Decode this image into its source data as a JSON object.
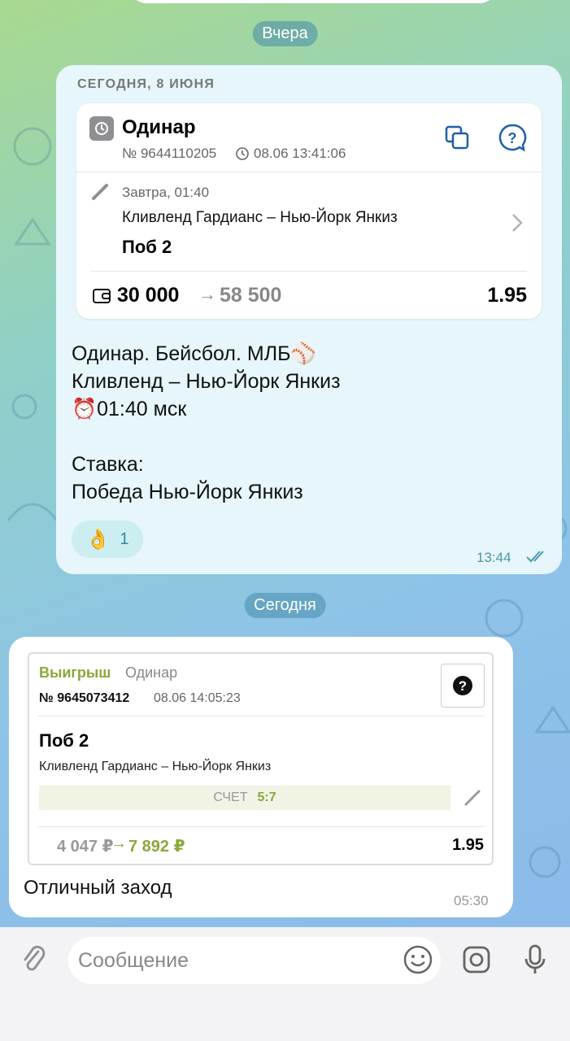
{
  "dates": {
    "yesterday": "Вчера",
    "today": "Сегодня"
  },
  "msg1": {
    "card_date": "СЕГОДНЯ, 8 ИЮНЯ",
    "bet_type": "Одинар",
    "bet_number": "№ 9644110205",
    "bet_time": "08.06 13:41:06",
    "event_time": "Завтра, 01:40",
    "match": "Кливленд Гардианс – Нью-Йорк Янкиз",
    "pick": "Поб 2",
    "stake": "30 000",
    "payout": "58 500",
    "odds": "1.95",
    "text_lines": [
      "Одинар. Бейсбол. МЛБ⚾️",
      "Кливленд – Нью-Йорк Янкиз",
      "⏰01:40 мск",
      "",
      "Ставка:",
      "Победа Нью-Йорк Янкиз"
    ],
    "reaction_emoji": "👌",
    "reaction_count": "1",
    "time": "13:44"
  },
  "msg2": {
    "status": "Выигрыш",
    "bet_type": "Одинар",
    "bet_number": "№ 9645073412",
    "bet_time": "08.06 14:05:23",
    "pick": "Поб 2",
    "match": "Кливленд Гардианс – Нью-Йорк Янкиз",
    "score_label": "СЧЕТ",
    "score": "5:7",
    "stake": "4 047 ₽",
    "payout": "7 892 ₽",
    "odds": "1.95",
    "caption": "Отличный заход",
    "time": "05:30"
  },
  "composer": {
    "placeholder": "Сообщение"
  },
  "colors": {
    "accent": "#2a7de1",
    "win_green": "#8aa83a",
    "bubble_bg": "#e6f6fb"
  }
}
